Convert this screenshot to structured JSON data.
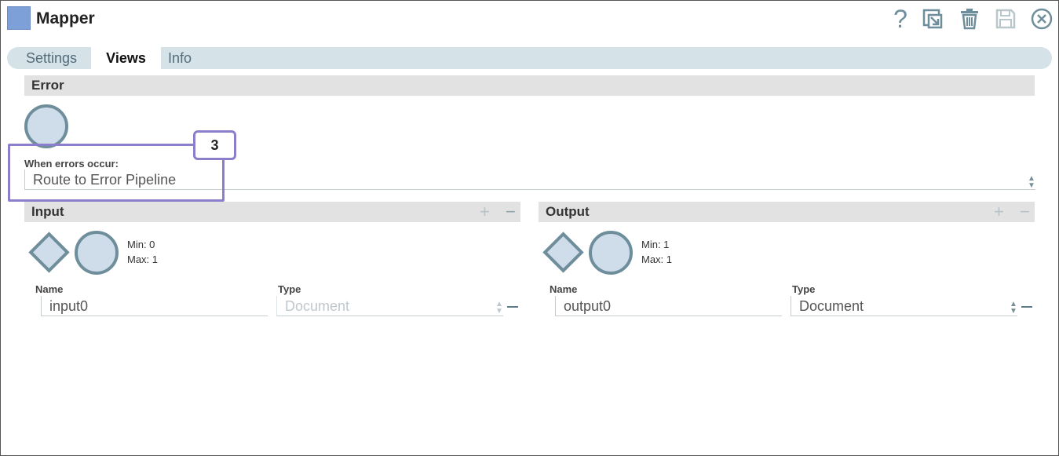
{
  "window": {
    "title": "Mapper"
  },
  "header_icons": [
    "help-icon",
    "export-icon",
    "trash-icon",
    "save-icon",
    "close-icon"
  ],
  "header_help_glyph": "?",
  "tabs": [
    {
      "label": "Settings",
      "active": false
    },
    {
      "label": "Views",
      "active": true
    },
    {
      "label": "Info",
      "active": false
    }
  ],
  "error_section": {
    "title": "Error",
    "field_label": "When errors occur:",
    "field_value": "Route to Error Pipeline"
  },
  "callout": {
    "number": "3"
  },
  "input_section": {
    "title": "Input",
    "add_label": "+",
    "remove_label": "−",
    "min": "Min: 0",
    "max": "Max: 1",
    "name_label": "Name",
    "type_label": "Type",
    "name_value": "input0",
    "type_value": "Document"
  },
  "output_section": {
    "title": "Output",
    "add_label": "+",
    "remove_label": "−",
    "min": "Min: 1",
    "max": "Max: 1",
    "name_label": "Name",
    "type_label": "Type",
    "name_value": "output0",
    "type_value": "Document"
  },
  "colors": {
    "accent_icon": "#7ea0d8",
    "tab_bar": "#d5e2e7",
    "callout": "#8c7ecb",
    "shape_fill": "#cfdcea",
    "shape_stroke": "#6f8e9c"
  }
}
